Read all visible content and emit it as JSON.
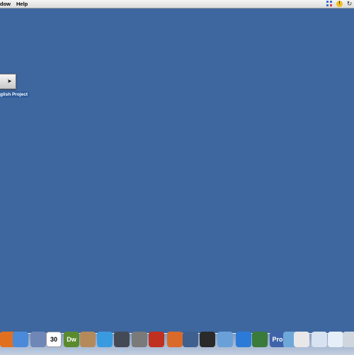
{
  "menubar": {
    "items": [
      "dow",
      "Help"
    ],
    "status": {
      "alert_glyph": "!",
      "sync_glyph": "↻"
    }
  },
  "desktop": {
    "icon_label": "glish Project"
  },
  "dock": {
    "items": [
      {
        "name": "firefox-icon",
        "glyph": "",
        "color": "#e07020"
      },
      {
        "name": "ichat-icon",
        "glyph": "",
        "color": "#4a8ad8"
      },
      {
        "name": "preview-icon",
        "glyph": "",
        "color": "#6f87b6"
      },
      {
        "name": "ical-icon",
        "glyph": "30",
        "color": "#ffffff"
      },
      {
        "name": "dreamweaver-icon",
        "glyph": "Dw",
        "color": "#5a8a2e"
      },
      {
        "name": "photo-icon",
        "glyph": "",
        "color": "#b58a5a"
      },
      {
        "name": "itunes-icon",
        "glyph": "",
        "color": "#3a9adf"
      },
      {
        "name": "spaces-icon",
        "glyph": "",
        "color": "#444a55"
      },
      {
        "name": "utility-icon",
        "glyph": "",
        "color": "#7a7a7a"
      },
      {
        "name": "record-icon",
        "glyph": "",
        "color": "#c03020"
      },
      {
        "name": "keynote-icon",
        "glyph": "",
        "color": "#d96a2a"
      },
      {
        "name": "pen-tool-icon",
        "glyph": "",
        "color": "#3f5f8f"
      },
      {
        "name": "imac-icon",
        "glyph": "",
        "color": "#2a2a2a"
      },
      {
        "name": "chart-icon",
        "glyph": "",
        "color": "#6aa0d8"
      },
      {
        "name": "globe-icon",
        "glyph": "",
        "color": "#2b7ad8"
      },
      {
        "name": "photo-booth-icon",
        "glyph": "",
        "color": "#3a7a3a"
      },
      {
        "name": "pro-app-icon",
        "glyph": "Pro",
        "color": "#3f63a8"
      },
      {
        "name": "folder-icon",
        "glyph": "",
        "color": "#6ea8d8"
      },
      {
        "name": "document-icon",
        "glyph": "",
        "color": "#e8e8e8"
      },
      {
        "name": "window-icon",
        "glyph": "",
        "color": "#d8e2f0"
      },
      {
        "name": "preview-window-icon",
        "glyph": "",
        "color": "#e6eef8"
      },
      {
        "name": "trash-icon",
        "glyph": "",
        "color": "#cfd6de"
      }
    ]
  }
}
